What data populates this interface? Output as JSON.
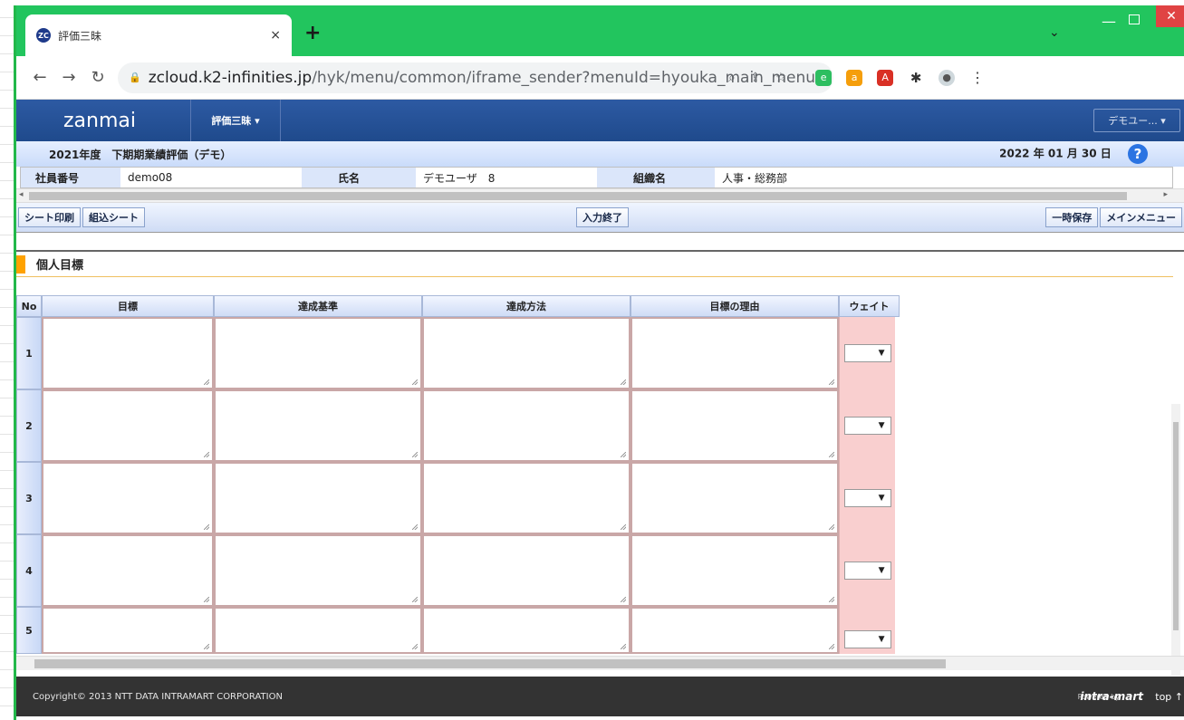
{
  "browser": {
    "tab_title": "評価三昧",
    "favicon_text": "ZC",
    "new_tab": "+",
    "tab_close": "×",
    "url_host": "zcloud.k2-infinities.jp",
    "url_path": "/hyk/menu/common/iframe_sender?menuId=hyouka_main_menu"
  },
  "app": {
    "logo": "zanmai",
    "menu_label": "評価三昧 ▾",
    "user_label": "デモユー... ▾",
    "period_title": "2021年度　下期期業績評価（デモ）",
    "date": "2022 年 01 月 30 日",
    "help": "?"
  },
  "employee": {
    "id_label": "社員番号",
    "id_value": "demo08",
    "name_label": "氏名",
    "name_value": "デモユーザ　8",
    "org_label": "組織名",
    "org_value": "人事・総務部"
  },
  "toolbar": {
    "print_sheet": "シート印刷",
    "combined_sheet": "組込シート",
    "input_done": "入力終了",
    "temp_save": "一時保存",
    "main_menu": "メインメニュー"
  },
  "section": {
    "title": "個人目標"
  },
  "goals_table": {
    "columns": [
      "No",
      "目標",
      "達成基準",
      "達成方法",
      "目標の理由",
      "ウェイト"
    ],
    "rows": [
      "1",
      "2",
      "3",
      "4",
      "5"
    ]
  },
  "footer": {
    "copyright": "Copyright© 2013 NTT DATA INTRAMART CORPORATION",
    "powered": "Powered by",
    "brand": "intra-mart",
    "top": "top ↑"
  }
}
